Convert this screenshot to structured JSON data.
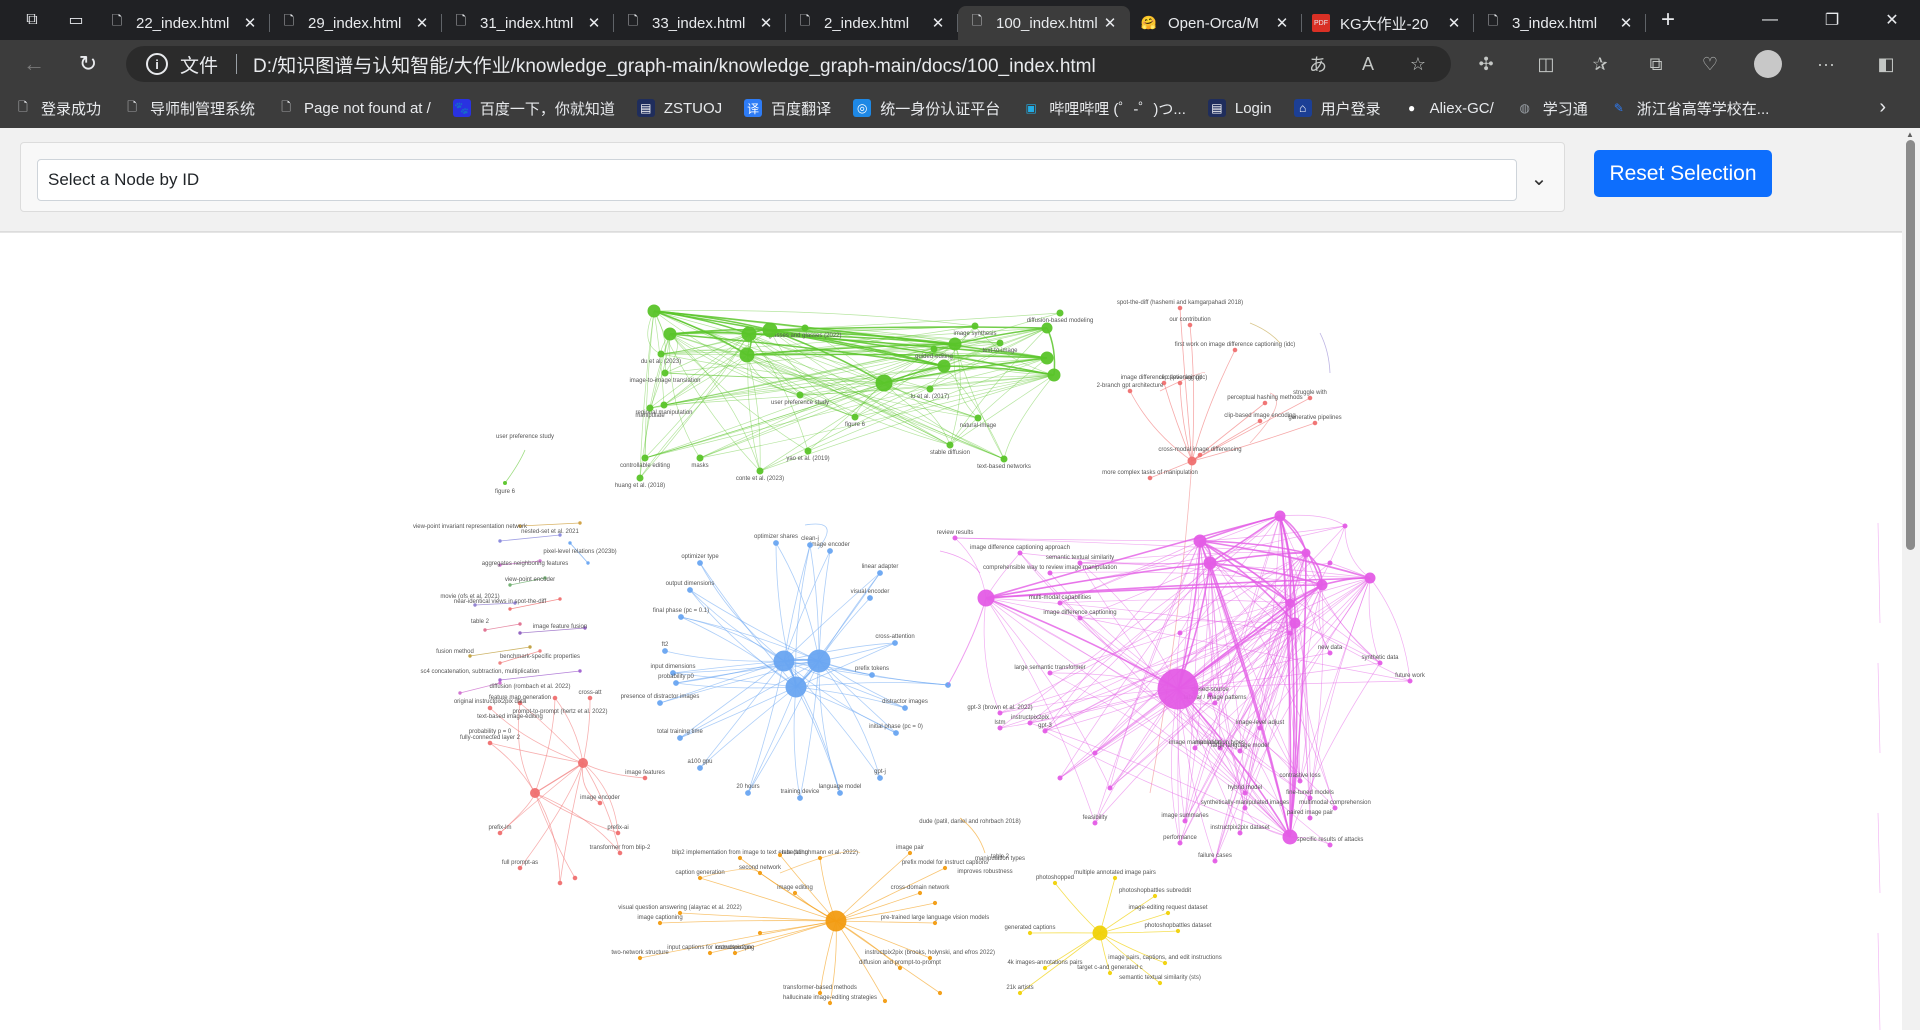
{
  "tabs": [
    {
      "title": "22_index.html",
      "active": false
    },
    {
      "title": "29_index.html",
      "active": false
    },
    {
      "title": "31_index.html",
      "active": false
    },
    {
      "title": "33_index.html",
      "active": false
    },
    {
      "title": "2_index.html",
      "active": false
    },
    {
      "title": "100_index.html",
      "active": true
    },
    {
      "title": "Open-Orca/M",
      "active": false
    },
    {
      "title": "KG大作业-20",
      "active": false
    },
    {
      "title": "3_index.html",
      "active": false
    }
  ],
  "address": {
    "scheme_label": "文件",
    "url": "D:/知识图谱与认知智能/大作业/knowledge_graph-main/knowledge_graph-main/docs/100_index.html"
  },
  "bookmarks": [
    {
      "label": "登录成功",
      "icon": "page-icon"
    },
    {
      "label": "导师制管理系统",
      "icon": "page-icon"
    },
    {
      "label": "Page not found at /",
      "icon": "page-icon"
    },
    {
      "label": "百度一下，你就知道",
      "icon": "baidu-icon"
    },
    {
      "label": "ZSTUOJ",
      "icon": "zstuoj-icon"
    },
    {
      "label": "百度翻译",
      "icon": "translate-icon"
    },
    {
      "label": "统一身份认证平台",
      "icon": "auth-icon"
    },
    {
      "label": "哔哩哔哩 (゜-゜)つ...",
      "icon": "bilibili-icon"
    },
    {
      "label": "Login",
      "icon": "login-icon"
    },
    {
      "label": "用户登录",
      "icon": "user-icon"
    },
    {
      "label": "Aliex-GC/",
      "icon": "github-icon"
    },
    {
      "label": "学习通",
      "icon": "globe-icon"
    },
    {
      "label": "浙江省高等学校在...",
      "icon": "zj-icon"
    }
  ],
  "controls": {
    "select_placeholder": "Select a Node by ID",
    "reset_label": "Reset Selection"
  },
  "graph": {
    "colors": {
      "green": "#5ac52a",
      "red": "#f07070",
      "magenta": "#e45ce6",
      "blue": "#6aa6f2",
      "orange": "#f39c12",
      "yellow": "#f1d20a"
    },
    "labels": {
      "green": [
        "glasses and glasses (2022)",
        "du et al. (2023)",
        "image-to-image translation",
        "regional manipulation",
        "manipulate",
        "controllable editing",
        "huang et al. (2018)",
        "conte et al. (2023)",
        "masks",
        "yao et al. (2019)",
        "lu et al. (2017)",
        "text-based networks",
        "stable diffusion",
        "natural-image",
        "text-to-image",
        "diffusion-based modeling",
        "guided-editing",
        "image synthesis",
        "user preference study",
        "figure 6"
      ],
      "red": [
        "spot-the-diff (hashemi and kamgarpahadi 2018)",
        "our contribution",
        "first work on image difference captioning (idc)",
        "image difference captioning (idc)",
        "clip (leveraging)",
        "2-branch gpt architecture",
        "perceptual hashing methods",
        "clip-based image encoding",
        "struggle with",
        "generative pipelines",
        "cross-modal image differencing",
        "more complex tasks of manipulation",
        "feature map generation",
        "cross-att",
        "fully-connected layer 2",
        "image encoder",
        "prefix-lm",
        "full prompt-as",
        "image features",
        "prefix-ai",
        "transformer from blip-2"
      ],
      "magenta": [
        "review results",
        "image difference captioning approach",
        "comprehensible way to review image manipulation",
        "semantic textual similarity",
        "multi-modal capabilities",
        "image difference captioning",
        "large semantic transformer",
        "gpt-3 (brown et al. 2022)",
        "instructpix2pix",
        "gpt-3",
        "lstm",
        "closed-source",
        "tabular / image patterns",
        "image manipulation",
        "manipulation types",
        "synthetically-manipulated images",
        "instructpix2pix dataset",
        "image summaries",
        "performance",
        "feasibility",
        "failure cases",
        "large language model",
        "contrastive loss",
        "fine-tuned models",
        "multimodal comprehension",
        "specific results of attacks",
        "paired image pair",
        "new data",
        "synthetic data",
        "future work",
        "hybrid model",
        "image-level adjust"
      ],
      "blue": [
        "optimizer shares",
        "optimizer type",
        "output dimensions",
        "final phase (pc = 0.1)",
        "ft2",
        "input dimensions",
        "probability p0",
        "presence of distractor images",
        "total training time",
        "a100 gpu",
        "20 hours",
        "training device",
        "language model",
        "gpt-j",
        "initial phase (pc = 0)",
        "distractor images",
        "prefix tokens",
        "cross-attention",
        "visual encoder",
        "linear adapter",
        "image encoder",
        "clean-j"
      ],
      "orange": [
        "caption generation",
        "blip2 implementation from image to text embedding",
        "second network",
        "image pair",
        "prefix model for instruct captions",
        "cross-domain network",
        "pre-trained large language vision models",
        "instructpix2pix (brooks, holynski, and efros 2022)",
        "diffusion and prompt-to-prompt",
        "late (schuhmann et al. 2022)",
        "image editing",
        "input captions for instructpix2pix",
        "visual question answering (alayrac et al. 2022)",
        "image captioning",
        "two-network structure",
        "crowdsourcing",
        "transformer-based methods",
        "hallucinate image-editing strategies"
      ],
      "yellow": [
        "photoshopped",
        "multiple annotated image pairs",
        "photoshopbattles subreddit",
        "image-editing request dataset",
        "photoshopbattles dataset",
        "image pairs, captions, and edit instructions",
        "semantic textual similarity (sts)",
        "target c-and generated c",
        "generated captions",
        "4k images-annotations pairs",
        "21k artists"
      ],
      "loose": [
        "view-point invariant representation network",
        "nested-set et al. 2021",
        "pixel-level relations (2023b)",
        "aggregates neighboring features",
        "view-point encoder",
        "movie (ofs et al. 2021)",
        "near-identical views in spot-the-diff",
        "table 2",
        "image feature fusion",
        "fusion method",
        "benchmark-specific properties",
        "sc4 concatenation, subtraction, multiplication",
        "diffusion (rombach et al. 2022)",
        "original instructpix2pix data",
        "text-based image-editing",
        "prompt-to-prompt (hertz et al. 2022)",
        "probability p = 0",
        "dude (patil, daniel and rohrbach 2018)",
        "manipulation types",
        "improves robustness",
        "table 2"
      ]
    }
  }
}
